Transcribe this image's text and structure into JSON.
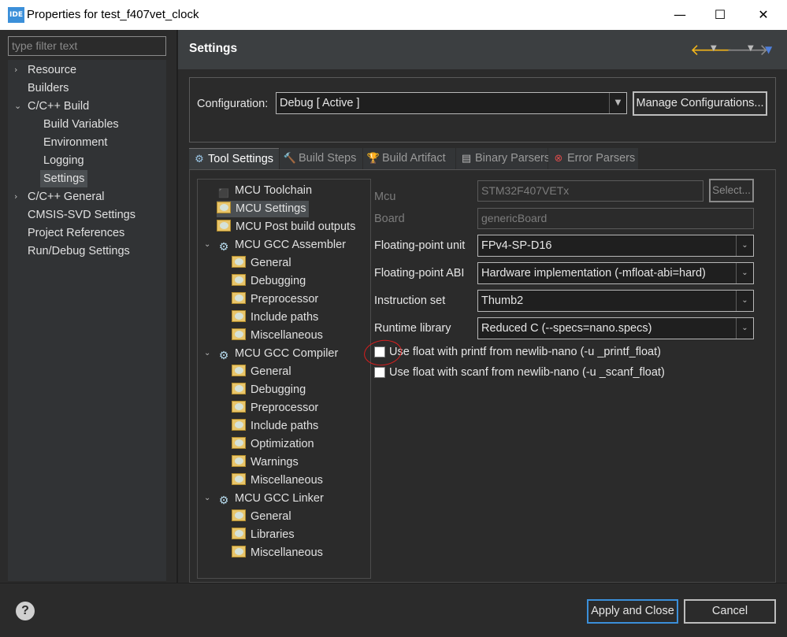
{
  "window": {
    "app_icon": "IDE",
    "title": "Properties for test_f407vet_clock",
    "minimize": "—",
    "maximize": "☐",
    "close": "✕"
  },
  "filter": {
    "placeholder": "type filter text"
  },
  "nav": {
    "items": [
      {
        "label": "Resource",
        "toggle": "›",
        "level": 0,
        "selected": false
      },
      {
        "label": "Builders",
        "toggle": "",
        "level": 0,
        "selected": false
      },
      {
        "label": "C/C++ Build",
        "toggle": "⌄",
        "level": 0,
        "selected": false
      },
      {
        "label": "Build Variables",
        "toggle": "",
        "level": 1,
        "selected": false
      },
      {
        "label": "Environment",
        "toggle": "",
        "level": 1,
        "selected": false
      },
      {
        "label": "Logging",
        "toggle": "",
        "level": 1,
        "selected": false
      },
      {
        "label": "Settings",
        "toggle": "",
        "level": 1,
        "selected": true
      },
      {
        "label": "C/C++ General",
        "toggle": "›",
        "level": 0,
        "selected": false
      },
      {
        "label": "CMSIS-SVD Settings",
        "toggle": "",
        "level": 0,
        "selected": false
      },
      {
        "label": "Project References",
        "toggle": "",
        "level": 0,
        "selected": false
      },
      {
        "label": "Run/Debug Settings",
        "toggle": "",
        "level": 0,
        "selected": false
      }
    ]
  },
  "header": {
    "title": "Settings",
    "back_icon": "back-arrow-icon",
    "forward_icon": "forward-arrow-icon",
    "colors": {
      "back": "#f2b51b",
      "forward": "#8a8a8a",
      "menu": "#4f7fdb"
    }
  },
  "configuration": {
    "label": "Configuration:",
    "value": "Debug  [ Active ]",
    "manage_button": "Manage Configurations..."
  },
  "tabs": [
    {
      "label": "Tool Settings",
      "icon": "⚙",
      "active": true
    },
    {
      "label": "Build Steps",
      "icon": "🔨",
      "active": false
    },
    {
      "label": "Build Artifact",
      "icon": "🏆",
      "active": false
    },
    {
      "label": "Binary Parsers",
      "icon": "▤",
      "active": false
    },
    {
      "label": "Error Parsers",
      "icon": "⊗",
      "active": false
    }
  ],
  "tool_tree": {
    "items": [
      {
        "label": "MCU Toolchain",
        "kind": "chip",
        "toggle": ""
      },
      {
        "label": "MCU Settings",
        "kind": "folder",
        "toggle": "",
        "selected": true
      },
      {
        "label": "MCU Post build outputs",
        "kind": "folder",
        "toggle": ""
      },
      {
        "label": "MCU GCC Assembler",
        "kind": "gear",
        "toggle": "⌄"
      },
      {
        "label": "General",
        "kind": "folder",
        "toggle": ""
      },
      {
        "label": "Debugging",
        "kind": "folder",
        "toggle": ""
      },
      {
        "label": "Preprocessor",
        "kind": "folder",
        "toggle": ""
      },
      {
        "label": "Include paths",
        "kind": "folder",
        "toggle": ""
      },
      {
        "label": "Miscellaneous",
        "kind": "folder",
        "toggle": ""
      },
      {
        "label": "MCU GCC Compiler",
        "kind": "gear",
        "toggle": "⌄"
      },
      {
        "label": "General",
        "kind": "folder",
        "toggle": ""
      },
      {
        "label": "Debugging",
        "kind": "folder",
        "toggle": ""
      },
      {
        "label": "Preprocessor",
        "kind": "folder",
        "toggle": ""
      },
      {
        "label": "Include paths",
        "kind": "folder",
        "toggle": ""
      },
      {
        "label": "Optimization",
        "kind": "folder",
        "toggle": ""
      },
      {
        "label": "Warnings",
        "kind": "folder",
        "toggle": ""
      },
      {
        "label": "Miscellaneous",
        "kind": "folder",
        "toggle": ""
      },
      {
        "label": "MCU GCC Linker",
        "kind": "gear",
        "toggle": "⌄"
      },
      {
        "label": "General",
        "kind": "folder",
        "toggle": ""
      },
      {
        "label": "Libraries",
        "kind": "folder",
        "toggle": ""
      },
      {
        "label": "Miscellaneous",
        "kind": "folder",
        "toggle": ""
      }
    ]
  },
  "form": {
    "mcu": {
      "label": "Mcu",
      "value": "STM32F407VETx",
      "button": "Select..."
    },
    "board": {
      "label": "Board",
      "value": "genericBoard"
    },
    "fpu": {
      "label": "Floating-point unit",
      "value": "FPv4-SP-D16"
    },
    "fabi": {
      "label": "Floating-point ABI",
      "value": "Hardware implementation (-mfloat-abi=hard)"
    },
    "iset": {
      "label": "Instruction set",
      "value": "Thumb2"
    },
    "runtime": {
      "label": "Runtime library",
      "value": "Reduced C (--specs=nano.specs)"
    },
    "printf_float": {
      "label": "Use float with printf from newlib-nano (-u _printf_float)",
      "checked": false
    },
    "scanf_float": {
      "label": "Use float with scanf from newlib-nano (-u _scanf_float)",
      "checked": false
    }
  },
  "footer": {
    "help": "?",
    "apply_close": "Apply and Close",
    "cancel": "Cancel"
  }
}
